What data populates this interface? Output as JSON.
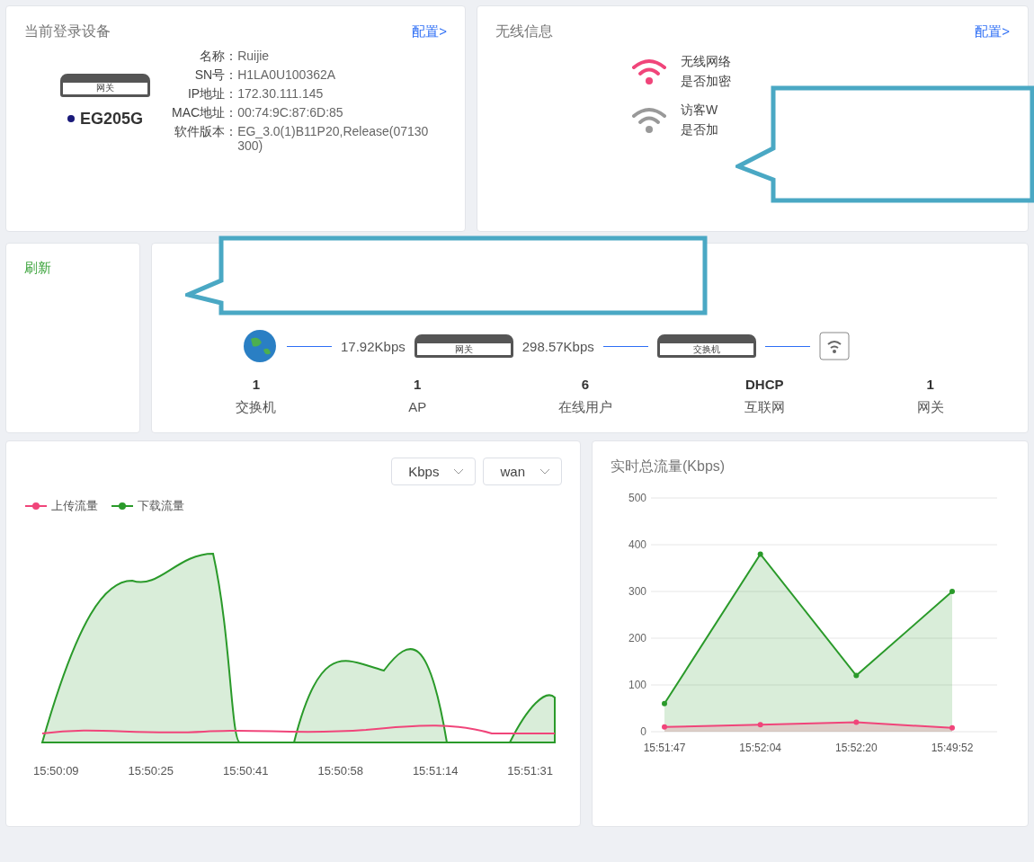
{
  "login_device": {
    "title": "当前登录设备",
    "config_link": "配置>",
    "device_label": "网关",
    "model": "EG205G",
    "online": true,
    "fields": [
      {
        "label": "名称：",
        "value": "Ruijie"
      },
      {
        "label": "SN号：",
        "value": "H1LA0U100362A"
      },
      {
        "label": "IP地址：",
        "value": "172.30.111.145"
      },
      {
        "label": "MAC地址：",
        "value": "00:74:9C:87:6D:85"
      },
      {
        "label": "软件版本：",
        "value": "EG_3.0(1)B11P20,Release(07130300)"
      }
    ]
  },
  "wireless": {
    "title": "无线信息",
    "config_link": "配置>",
    "networks": [
      {
        "name": "无线网络",
        "encryption": "是否加密",
        "enabled": true
      },
      {
        "name": "访客W",
        "encryption": "是否加",
        "enabled": false
      }
    ]
  },
  "refresh_link": "刷新",
  "topology": {
    "upload_rate": "17.92Kbps",
    "download_rate": "298.57Kbps",
    "gateway_label": "网关",
    "switch_label": "交换机",
    "stats": [
      {
        "value": "1",
        "label": "交换机"
      },
      {
        "value": "1",
        "label": "AP"
      },
      {
        "value": "6",
        "label": "在线用户"
      },
      {
        "value": "DHCP",
        "label": "互联网"
      },
      {
        "value": "1",
        "label": "网关"
      }
    ]
  },
  "traffic": {
    "unit_select": "Kbps",
    "interface_select": "wan",
    "legend": [
      {
        "name": "上传流量",
        "color": "#f0457a"
      },
      {
        "name": "下载流量",
        "color": "#2a9a2a"
      }
    ],
    "time_labels": [
      "15:50:09",
      "15:50:25",
      "15:50:41",
      "15:50:58",
      "15:51:14",
      "15:51:31"
    ]
  },
  "total_traffic": {
    "title": "实时总流量(Kbps)",
    "chart_data": {
      "type": "area",
      "categories": [
        "15:51:47",
        "15:52:04",
        "15:52:20",
        "15:49:52"
      ],
      "ylim": [
        0,
        500
      ],
      "grid": true,
      "yticks": [
        0,
        100,
        200,
        300,
        400,
        500
      ],
      "series": [
        {
          "color": "#2a9a2a",
          "values": [
            60,
            380,
            120,
            300
          ]
        },
        {
          "color": "#f0457a",
          "values": [
            10,
            15,
            20,
            8
          ]
        }
      ]
    }
  }
}
